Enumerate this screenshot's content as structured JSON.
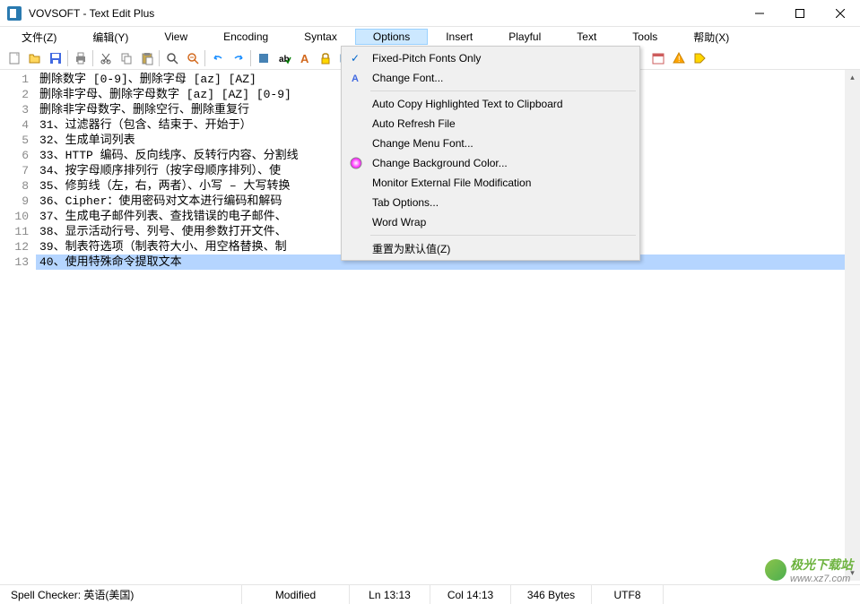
{
  "titlebar": {
    "title": "VOVSOFT - Text Edit Plus"
  },
  "menubar": {
    "items": [
      {
        "label": "文件(Z)"
      },
      {
        "label": "编辑(Y)"
      },
      {
        "label": "View"
      },
      {
        "label": "Encoding"
      },
      {
        "label": "Syntax"
      },
      {
        "label": "Options",
        "active": true
      },
      {
        "label": "Insert"
      },
      {
        "label": "Playful"
      },
      {
        "label": "Text"
      },
      {
        "label": "Tools"
      },
      {
        "label": "帮助(X)"
      }
    ]
  },
  "dropdown": {
    "items": [
      {
        "label": "Fixed-Pitch Fonts Only",
        "checked": true
      },
      {
        "label": "Change Font...",
        "icon": "font"
      },
      {
        "sep": true
      },
      {
        "label": "Auto Copy Highlighted Text to Clipboard"
      },
      {
        "label": "Auto Refresh File"
      },
      {
        "label": "Change Menu Font..."
      },
      {
        "label": "Change Background Color...",
        "icon": "color"
      },
      {
        "label": "Monitor External File Modification"
      },
      {
        "label": "Tab Options..."
      },
      {
        "label": "Word Wrap"
      },
      {
        "sep": true
      },
      {
        "label": "重置为默认值(Z)"
      }
    ]
  },
  "editor": {
    "lines": [
      "删除数字 [0-9]、删除字母 [az] [AZ]",
      "删除非字母、删除字母数字 [az] [AZ] [0-9]",
      "删除非字母数字、删除空行、删除重复行",
      "31、过滤器行（包含、结束于、开始于）",
      "32、生成单词列表",
      "33、HTTP 编码、反向线序、反转行内容、分割线",
      "34、按字母顺序排列行（按字母顺序排列）、使",
      "35、修剪线（左，右，两者）、小写 – 大写转换",
      "36、Cipher：使用密码对文本进行编码和解码",
      "37、生成电子邮件列表、查找错误的电子邮件、",
      "38、显示活动行号、列号、使用参数打开文件、",
      "39、制表符选项（制表符大小、用空格替换、制",
      "40、使用特殊命令提取文本"
    ],
    "selected_line": 12
  },
  "statusbar": {
    "spell": "Spell Checker: 英语(美国)",
    "modified": "Modified",
    "ln": "Ln 13:13",
    "col": "Col 14:13",
    "bytes": "346 Bytes",
    "encoding": "UTF8"
  },
  "watermark": {
    "text": "极光下载站",
    "url": "www.xz7.com"
  }
}
